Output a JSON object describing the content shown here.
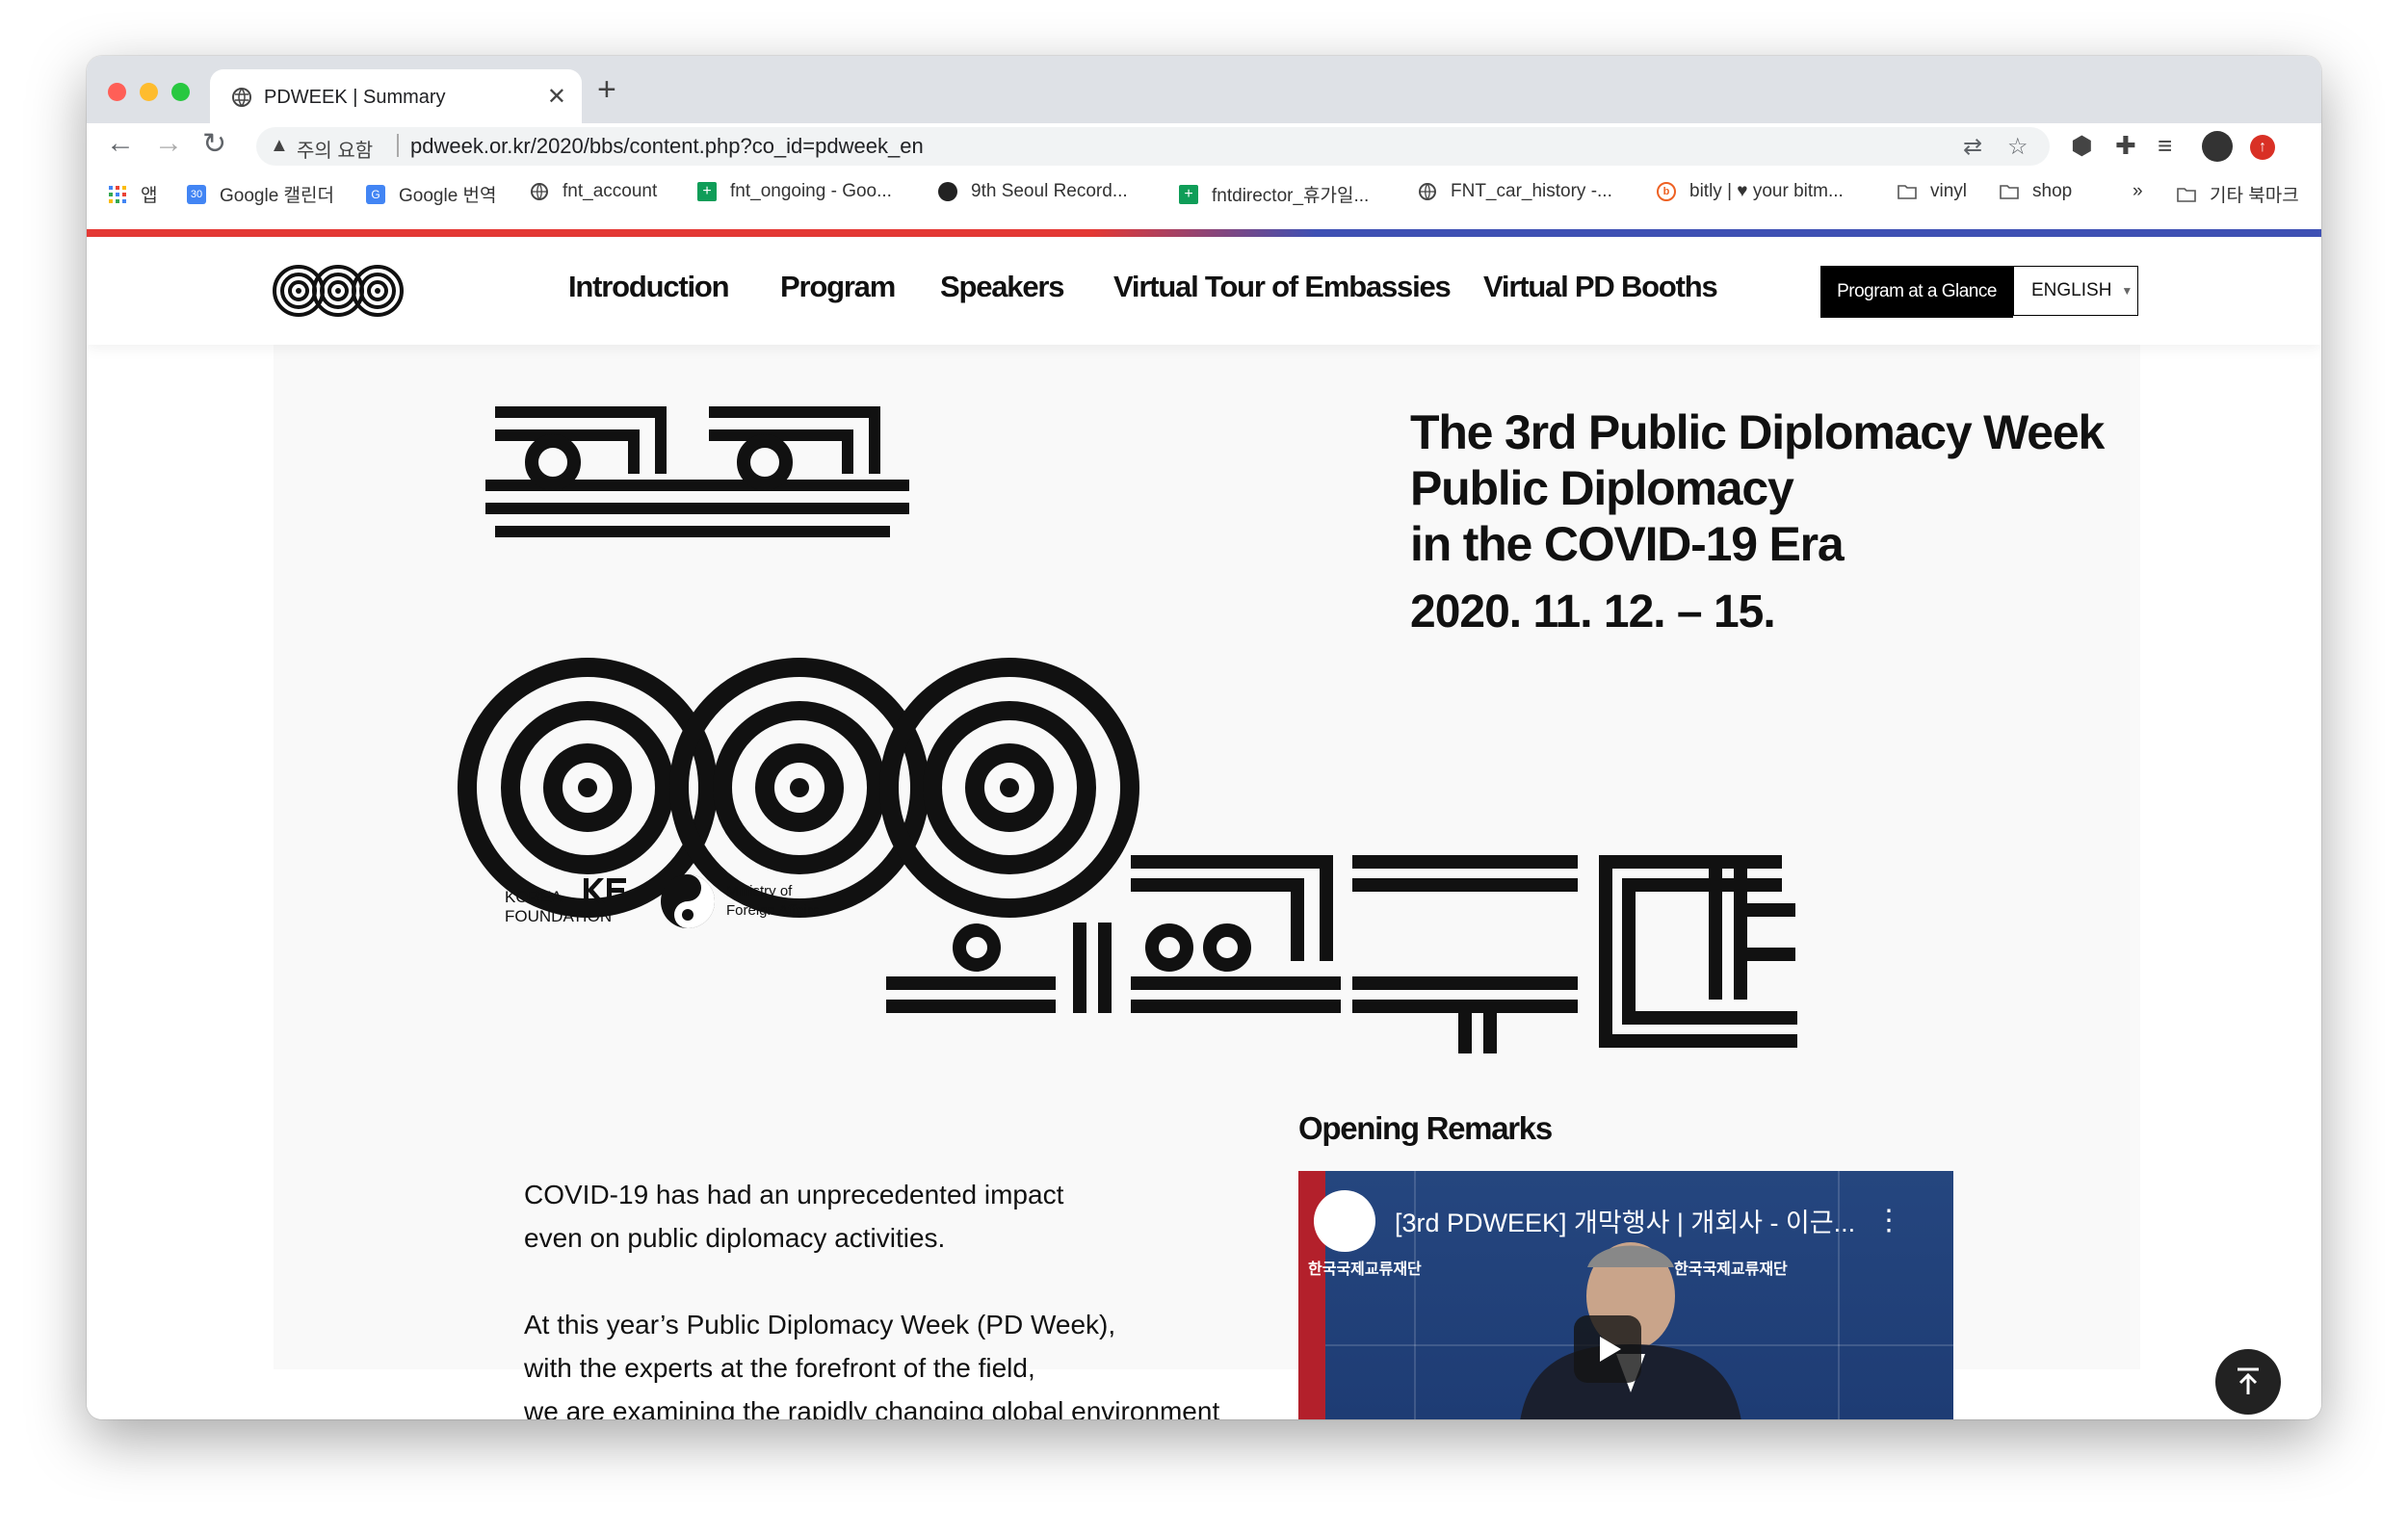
{
  "browser": {
    "tab_title": "PDWEEK | Summary",
    "security_label": "주의 요함",
    "url": "pdweek.or.kr/2020/bbs/content.php?co_id=pdweek_en",
    "bookmarks": [
      {
        "label": "앱",
        "icon": "apps-icon"
      },
      {
        "label": "Google 캘린더",
        "icon": "calendar-icon"
      },
      {
        "label": "Google 번역",
        "icon": "translate-icon"
      },
      {
        "label": "fnt_account",
        "icon": "globe-icon"
      },
      {
        "label": "fnt_ongoing - Goo...",
        "icon": "sheets-icon"
      },
      {
        "label": "9th Seoul Record...",
        "icon": "record-icon"
      },
      {
        "label": "fntdirector_휴가일...",
        "icon": "sheets-icon"
      },
      {
        "label": "FNT_car_history -...",
        "icon": "globe-icon"
      },
      {
        "label": "bitly | ♥ your bitm...",
        "icon": "bitly-icon"
      },
      {
        "label": "vinyl",
        "icon": "folder-icon"
      },
      {
        "label": "shop",
        "icon": "folder-icon"
      }
    ],
    "overflow": "»",
    "other_bookmarks": "기타 북마크"
  },
  "site": {
    "nav": [
      "Introduction",
      "Program",
      "Speakers",
      "Virtual Tour of Embassies",
      "Virtual PD Booths"
    ],
    "glance_button": "Program at a Glance",
    "language": "ENGLISH"
  },
  "hero": {
    "title_line1": "The 3rd Public Diplomacy Week",
    "title_line2": "Public Diplomacy",
    "title_line3": "in the COVID-19 Era",
    "date": "2020. 11. 12. – 15.",
    "kf_line1": "KOREA",
    "kf_line2": "FOUNDATION",
    "mofa_line1": "Ministry of",
    "mofa_line2": "Foreign Affairs"
  },
  "main": {
    "opening_heading": "Opening Remarks",
    "para1_line1": "COVID-19 has had an unprecedented impact",
    "para1_line2": "even on public diplomacy activities.",
    "para2_line1": "At this year’s Public Diplomacy Week (PD Week),",
    "para2_line2": "with the experts at the forefront of the field,",
    "para2_line3": "we are examining the rapidly changing global environment",
    "video_title": "[3rd PDWEEK] 개막행사 | 개회사 - 이근...",
    "video_channel_text": "한국국제교류재단"
  },
  "colors": {
    "stripe_red": "#e53935",
    "stripe_blue": "#3f51b5",
    "brand_black": "#111111"
  }
}
